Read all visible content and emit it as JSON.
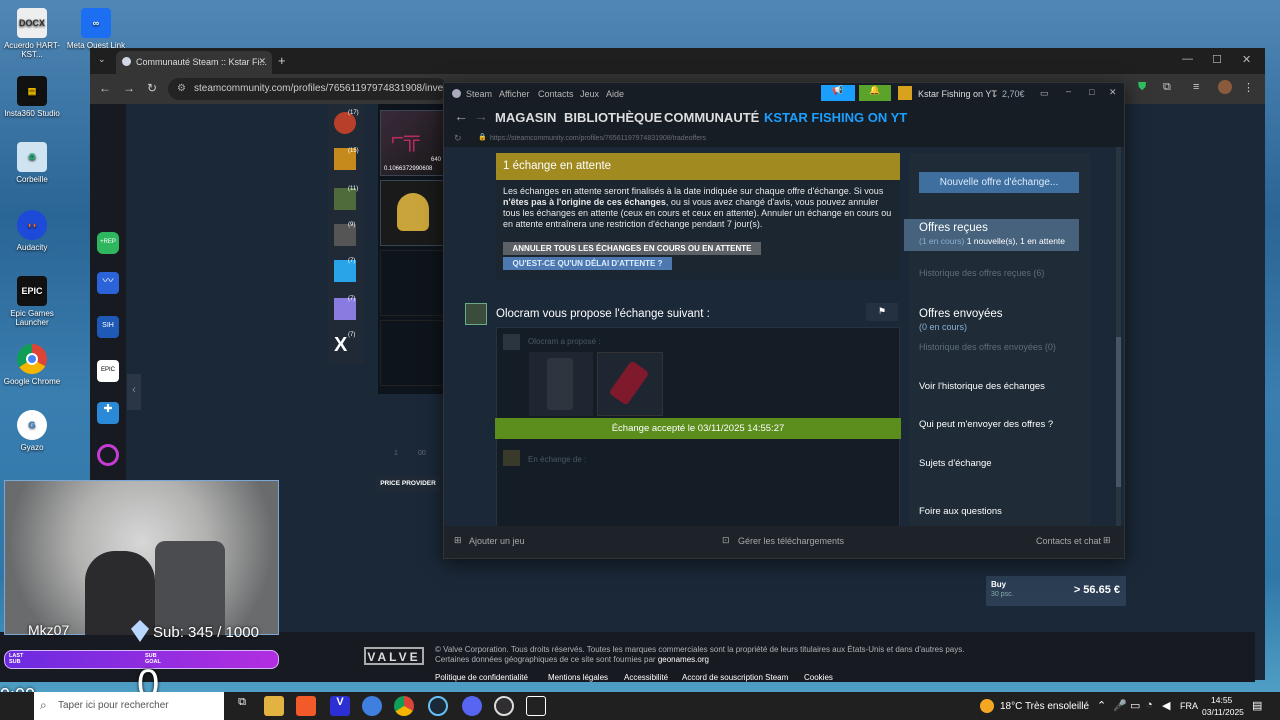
{
  "desktop": {
    "icons": [
      {
        "label": "Acuerdo HART-KST...",
        "icon": "docx-icon"
      },
      {
        "label": "Meta Quest Link",
        "icon": "meta-icon"
      },
      {
        "label": "Insta360 Studio",
        "icon": "film-icon"
      },
      {
        "label": "Corbeille",
        "icon": "recycle-bin-icon"
      },
      {
        "label": "Audacity",
        "icon": "audacity-icon"
      },
      {
        "label": "Epic Games Launcher",
        "icon": "epic-icon"
      },
      {
        "label": "Google Chrome",
        "icon": "chrome-icon"
      },
      {
        "label": "Gyazo",
        "icon": "gyazo-icon"
      }
    ]
  },
  "browser": {
    "tab_title": "Communauté Steam :: Kstar Fi...",
    "url": "steamcommunity.com/profiles/76561197974831908/invento"
  },
  "behind_page": {
    "item_price": "640",
    "item_float": "0.1066372990608",
    "badges": [
      "(17)",
      "(15)",
      "(11)",
      "(9)",
      "(7)",
      "(7)",
      "(7)"
    ],
    "price_provider": "PRICE PROVIDER",
    "pager": [
      "1",
      "00"
    ]
  },
  "steam": {
    "menu": [
      "Steam",
      "Afficher",
      "Contacts",
      "Jeux",
      "Aide"
    ],
    "account_name": "Kstar Fishing on YT",
    "balance": "2,70€",
    "nav": [
      "MAGASIN",
      "BIBLIOTHÈQUE",
      "COMMUNAUTÉ",
      "KSTAR FISHING ON YT"
    ],
    "url": "https://steamcommunity.com/profiles/76561197974831908/tradeoffers",
    "hold_title": "1 échange en attente",
    "hold_text_1": "Les échanges en attente seront finalisés à la date indiquée sur chaque offre d'échange. Si vous ",
    "hold_text_bold": "n'êtes pas à l'origine de ces échanges",
    "hold_text_2": ", ou si vous avez changé d'avis, vous pouvez annuler tous les échanges en attente (ceux en cours et ceux en attente). Annuler un échange en cours ou en attente entraînera une restriction d'échange pendant 7 jour(s).",
    "cancel_all": "ANNULER TOUS LES ÉCHANGES EN COURS OU EN ATTENTE",
    "what_is_hold": "QU'EST-CE QU'UN DÉLAI D'ATTENTE ?",
    "offer_title": "Olocram vous propose l'échange suivant :",
    "offered_label": "Olocram a proposé :",
    "accepted": "Échange accepté le 03/11/2025 14:55:27",
    "in_exchange": "En échange de :",
    "new_offer": "Nouvelle offre d'échange...",
    "received": "Offres reçues",
    "received_sub_dim": "(1 en cours)",
    "received_sub": " 1 nouvelle(s), 1 en attente",
    "received_history": "Historique des offres reçues (6)",
    "sent": "Offres envoyées",
    "sent_sub": "(0 en cours)",
    "sent_history": "Historique des offres envoyées (0)",
    "links": [
      "Voir l'historique des échanges",
      "Qui peut m'envoyer des offres ?",
      "Sujets d'échange",
      "Foire aux questions"
    ],
    "add_game": "Ajouter un jeu",
    "downloads": "Gérer les téléchargements",
    "friends": "Contacts et chat"
  },
  "buy_widget": {
    "label": "Buy",
    "sub": "30 psc.",
    "price": "> 56.65 €"
  },
  "footer": {
    "logo": "VALVE",
    "copyright": "© Valve Corporation. Tous droits réservés. Toutes les marques commerciales sont la propriété de leurs titulaires aux États-Unis et dans d'autres pays.",
    "geo": "Certaines données géographiques de ce site sont fournies par ",
    "geo_link": "geonames.org",
    "links": [
      "Politique de confidentialité",
      "Mentions légales",
      "Accessibilité",
      "Accord de souscription Steam",
      "Cookies"
    ]
  },
  "stream_overlay": {
    "user": "Mkz07",
    "sub": "Sub: 345 / 1000",
    "last_sub": "LAST SUB",
    "sub_goal": "SUB GOAL",
    "timer": "0:00",
    "counter": "0"
  },
  "taskbar": {
    "search": "Taper ici pour rechercher",
    "weather": "18°C  Très ensoleillé",
    "lang": "FRA",
    "time": "14:55",
    "date": "03/11/2025"
  }
}
